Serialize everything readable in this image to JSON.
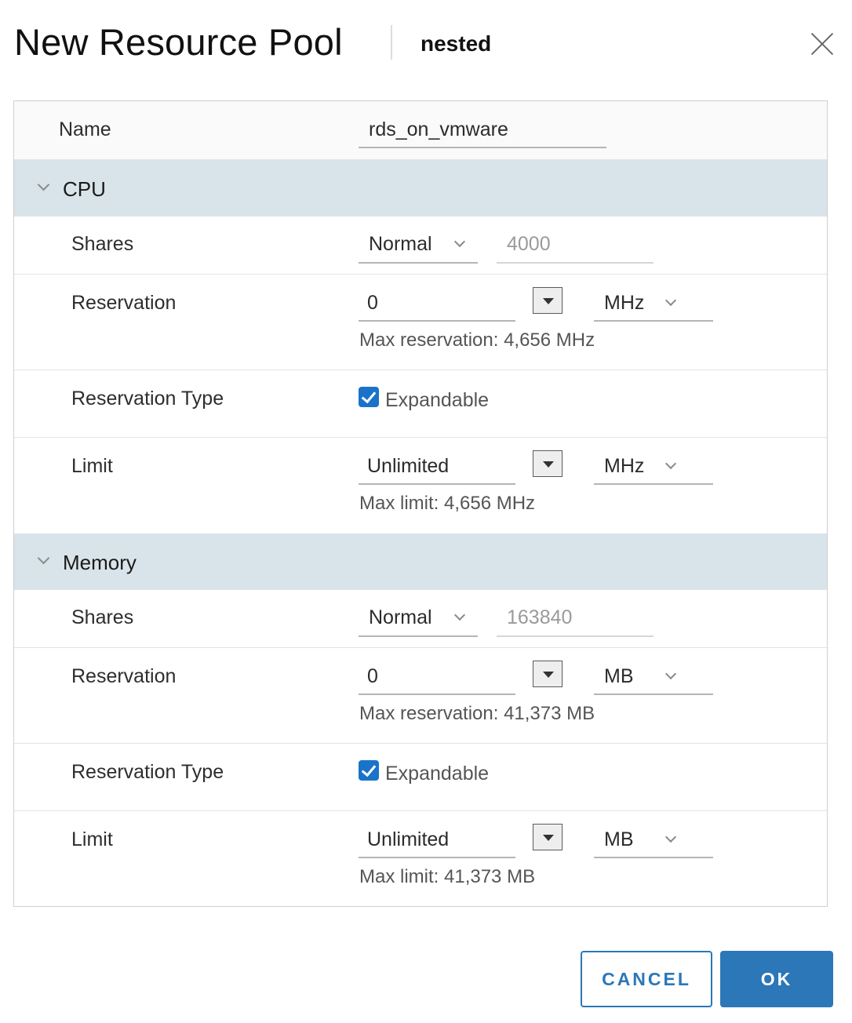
{
  "dialog": {
    "title": "New Resource Pool",
    "subtitle": "nested",
    "close_icon": "close-icon"
  },
  "name": {
    "label": "Name",
    "value": "rds_on_vmware"
  },
  "cpu": {
    "section_label": "CPU",
    "shares": {
      "label": "Shares",
      "level": "Normal",
      "value": "4000"
    },
    "reservation": {
      "label": "Reservation",
      "value": "0",
      "unit": "MHz",
      "hint": "Max reservation: 4,656 MHz"
    },
    "reservation_type": {
      "label": "Reservation Type",
      "checkbox_label": "Expandable",
      "checked": true
    },
    "limit": {
      "label": "Limit",
      "value": "Unlimited",
      "unit": "MHz",
      "hint": "Max limit: 4,656 MHz"
    }
  },
  "memory": {
    "section_label": "Memory",
    "shares": {
      "label": "Shares",
      "level": "Normal",
      "value": "163840"
    },
    "reservation": {
      "label": "Reservation",
      "value": "0",
      "unit": "MB",
      "hint": "Max reservation: 41,373 MB"
    },
    "reservation_type": {
      "label": "Reservation Type",
      "checkbox_label": "Expandable",
      "checked": true
    },
    "limit": {
      "label": "Limit",
      "value": "Unlimited",
      "unit": "MB",
      "hint": "Max limit: 41,373 MB"
    }
  },
  "footer": {
    "cancel_label": "CANCEL",
    "ok_label": "OK"
  },
  "colors": {
    "accent": "#2b77b8",
    "section_bg": "#d9e4ea",
    "checkbox": "#1a73c9"
  }
}
